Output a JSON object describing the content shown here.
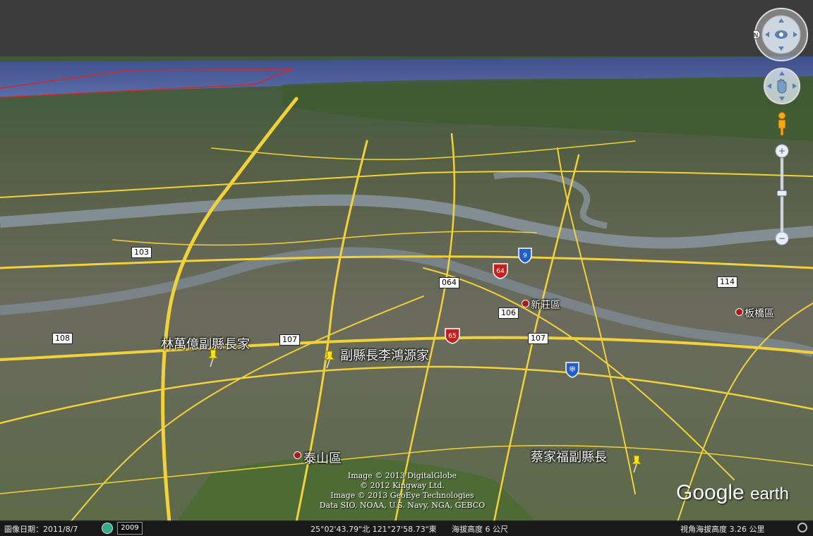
{
  "map": {
    "district_labels": [
      {
        "id": "xinzhuang",
        "text": "新莊區"
      },
      {
        "id": "banqiao",
        "text": "板橋區"
      },
      {
        "id": "taishan",
        "text": "泰山區"
      }
    ],
    "placemarks": [
      {
        "id": "lin",
        "text": "林萬億副縣長家"
      },
      {
        "id": "li",
        "text": "副縣長李鴻源家"
      },
      {
        "id": "tsai",
        "text": "蔡家福副縣長"
      }
    ],
    "road_labels": [
      {
        "id": "r108",
        "text": "108"
      },
      {
        "id": "r107",
        "text": "107"
      },
      {
        "id": "r107b",
        "text": "107"
      },
      {
        "id": "r106",
        "text": "106"
      },
      {
        "id": "r103",
        "text": "103"
      },
      {
        "id": "r064",
        "text": "064"
      },
      {
        "id": "r114",
        "text": "114"
      }
    ],
    "highway_shields": [
      {
        "id": "h64",
        "text": "64",
        "color": "#c81e1e"
      },
      {
        "id": "h65",
        "text": "65",
        "color": "#c81e1e"
      },
      {
        "id": "h9",
        "text": "9",
        "color": "#1e5fc8"
      },
      {
        "id": "hjia",
        "text": "甲",
        "color": "#1e5fc8"
      }
    ],
    "attribution_lines": [
      "Image © 2013 DigitalGlobe",
      "© 2012 Kingway Ltd.",
      "Image © 2013 GeoEye Technologies",
      "Data SIO, NOAA, U.S. Navy, NGA, GEBCO"
    ],
    "logo": {
      "brand": "Google",
      "product": "earth"
    }
  },
  "status_bar": {
    "imagery_date_label": "圖像日期：2011/8/7",
    "year": "2009",
    "coordinates": "25°02'43.79\"北  121°27'58.73\"東",
    "elevation": "海拔高度     6 公尺",
    "eye_altitude": "視角海拔高度    3.26 公里"
  },
  "controls": {
    "look_icon": "eye-icon",
    "move_icon": "hand-icon",
    "pegman_icon": "pegman-icon",
    "zoom_in": "+",
    "zoom_out": "−",
    "compass_letter": "N"
  },
  "colors": {
    "road": "#f2d23a",
    "river": "#7c8a96",
    "terrain": "#4d6330",
    "urban": "#6f6f66"
  }
}
